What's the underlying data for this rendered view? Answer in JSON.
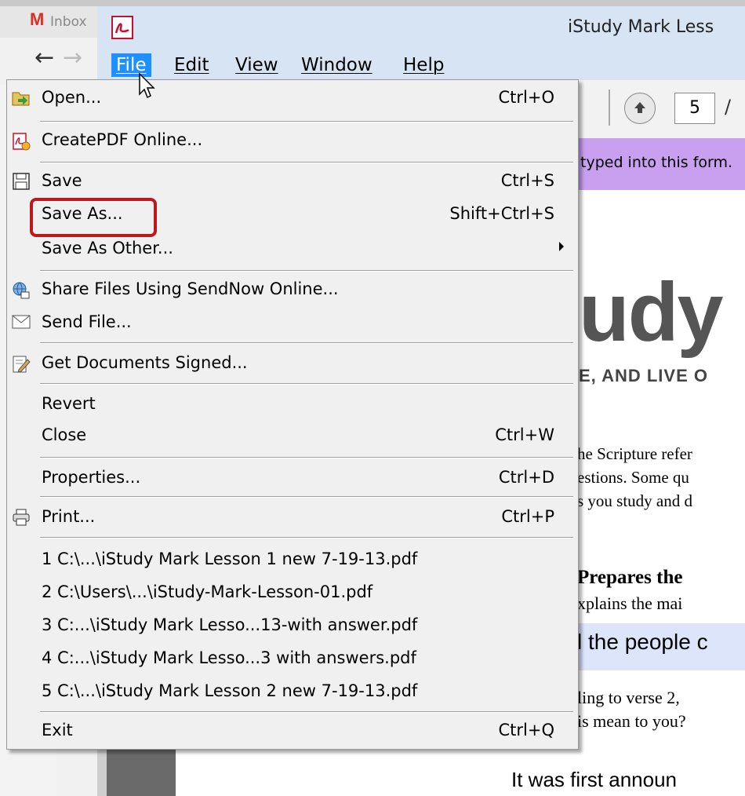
{
  "browser": {
    "tab_title": "Inbox",
    "logo_letter": "M",
    "back_icon": "←",
    "forward_icon": "→"
  },
  "reader": {
    "window_title": "iStudy Mark Less",
    "menus": [
      "File",
      "Edit",
      "View",
      "Window",
      "Help"
    ],
    "toolbar": {
      "page_number": "5",
      "page_separator": "/"
    },
    "form_notice": "typed into this form.",
    "accent_color": "#1e90ff"
  },
  "document": {
    "heading_fragment": "udy",
    "subtitle_fragment": "E, AND LIVE O",
    "para_line1": "he Scripture refer",
    "para_line2": "estions. Some qu",
    "para_line3": "s you study and d",
    "section_heading": "Prepares the",
    "section_line": "xplains the mai",
    "highlight_text": "l the people c",
    "line_a": "ling to verse 2,",
    "line_b": "is mean to you?",
    "line_c": "It was first announ"
  },
  "file_menu": {
    "open": {
      "label": "Open...",
      "shortcut": "Ctrl+O",
      "icon": "open-folder-icon"
    },
    "create_pdf": {
      "label": "CreatePDF Online...",
      "icon": "create-pdf-icon"
    },
    "save": {
      "label": "Save",
      "shortcut": "Ctrl+S",
      "icon": "save-disk-icon"
    },
    "save_as": {
      "label": "Save As...",
      "shortcut": "Shift+Ctrl+S"
    },
    "save_as_other": {
      "label": "Save As Other..."
    },
    "share": {
      "label": "Share Files Using SendNow Online...",
      "icon": "share-globe-icon"
    },
    "send_file": {
      "label": "Send File...",
      "icon": "envelope-icon"
    },
    "get_signed": {
      "label": "Get Documents Signed...",
      "icon": "sign-document-icon"
    },
    "revert": {
      "label": "Revert"
    },
    "close": {
      "label": "Close",
      "shortcut": "Ctrl+W"
    },
    "properties": {
      "label": "Properties...",
      "shortcut": "Ctrl+D"
    },
    "print": {
      "label": "Print...",
      "shortcut": "Ctrl+P",
      "icon": "printer-icon"
    },
    "recent": [
      "1 C:\\...\\iStudy Mark Lesson 1 new 7-19-13.pdf",
      "2 C:\\Users\\...\\iStudy-Mark-Lesson-01.pdf",
      "3 C:...\\iStudy Mark Lesso...13-with answer.pdf",
      "4 C:...\\iStudy Mark Lesso...3 with answers.pdf",
      "5 C:\\...\\iStudy Mark Lesson 2 new 7-19-13.pdf"
    ],
    "exit": {
      "label": "Exit",
      "shortcut": "Ctrl+Q"
    },
    "highlight_color": "#c0161c"
  }
}
